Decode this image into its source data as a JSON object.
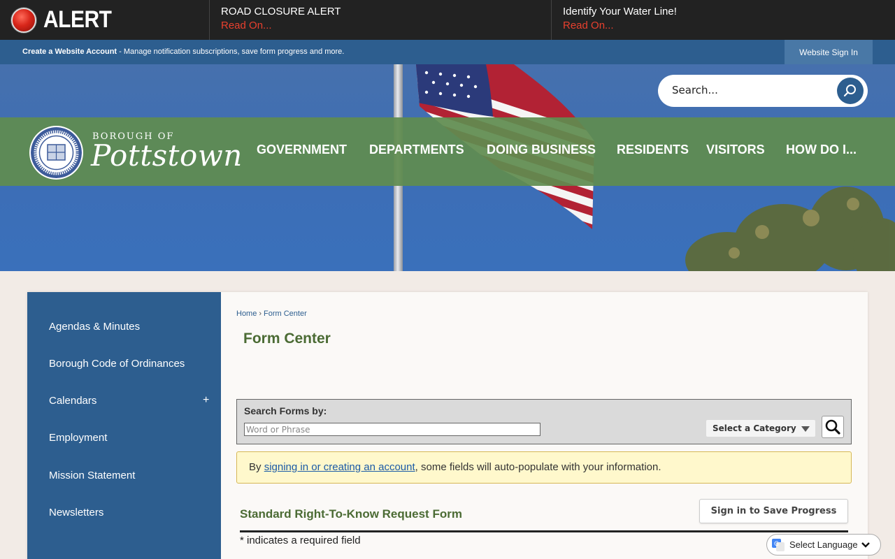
{
  "alert_bar": {
    "brand_label": "ALERT",
    "items": [
      {
        "title": "ROAD CLOSURE ALERT",
        "link": "Read On..."
      },
      {
        "title": "Identify Your Water Line!",
        "link": "Read On..."
      }
    ]
  },
  "account_bar": {
    "create_link": "Create a Website Account",
    "description": " - Manage notification subscriptions, save form progress and more.",
    "sign_in": "Website Sign In"
  },
  "header": {
    "search_placeholder": "Search...",
    "logo_small": "BOROUGH OF",
    "logo_big": "Pottstown",
    "nav": [
      "GOVERNMENT",
      "DEPARTMENTS",
      "DOING BUSINESS",
      "RESIDENTS",
      "VISITORS",
      "HOW DO I..."
    ]
  },
  "sidebar": {
    "items": [
      "Agendas & Minutes",
      "Borough Code of Ordinances",
      "Calendars",
      "Employment",
      "Mission Statement",
      "Newsletters"
    ],
    "expand_symbol": "+"
  },
  "breadcrumb": {
    "home": "Home",
    "separator": "›",
    "current": "Form Center"
  },
  "page_title": "Form Center",
  "search_forms": {
    "label": "Search Forms by:",
    "placeholder": "Word or Phrase",
    "category": "Select a Category"
  },
  "notice": {
    "prefix": "By ",
    "link": "signing in or creating an account",
    "suffix": ", some fields will auto-populate with your information."
  },
  "form": {
    "title": "Standard Right-To-Know Request Form",
    "save_button": "Sign in to Save Progress",
    "required_note": "* indicates a required field"
  },
  "language": {
    "label": "Select Language"
  },
  "colors": {
    "alert_bg": "#222222",
    "alert_link": "#e8402e",
    "brand_blue": "#2d5e8f",
    "nav_green": "#608c50",
    "title_green": "#4b6b34",
    "notice_bg": "#fff8cc"
  }
}
